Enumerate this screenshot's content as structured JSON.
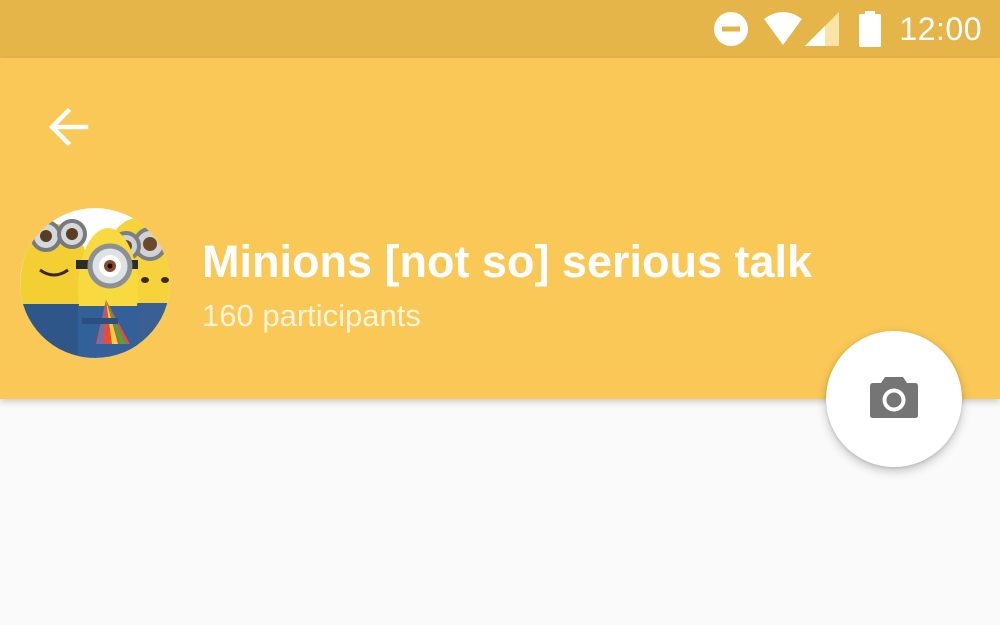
{
  "status_bar": {
    "time": "12:00",
    "icons": [
      "do-not-disturb-icon",
      "wifi-icon",
      "cell-signal-icon",
      "battery-icon"
    ]
  },
  "app_bar": {
    "back_icon": "arrow-back-icon",
    "group_name": "Minions [not so] serious talk",
    "participants": "160 participants",
    "background_color": "#f9c857",
    "status_bar_color": "#e6b54a"
  },
  "fab": {
    "icon": "camera-icon"
  }
}
